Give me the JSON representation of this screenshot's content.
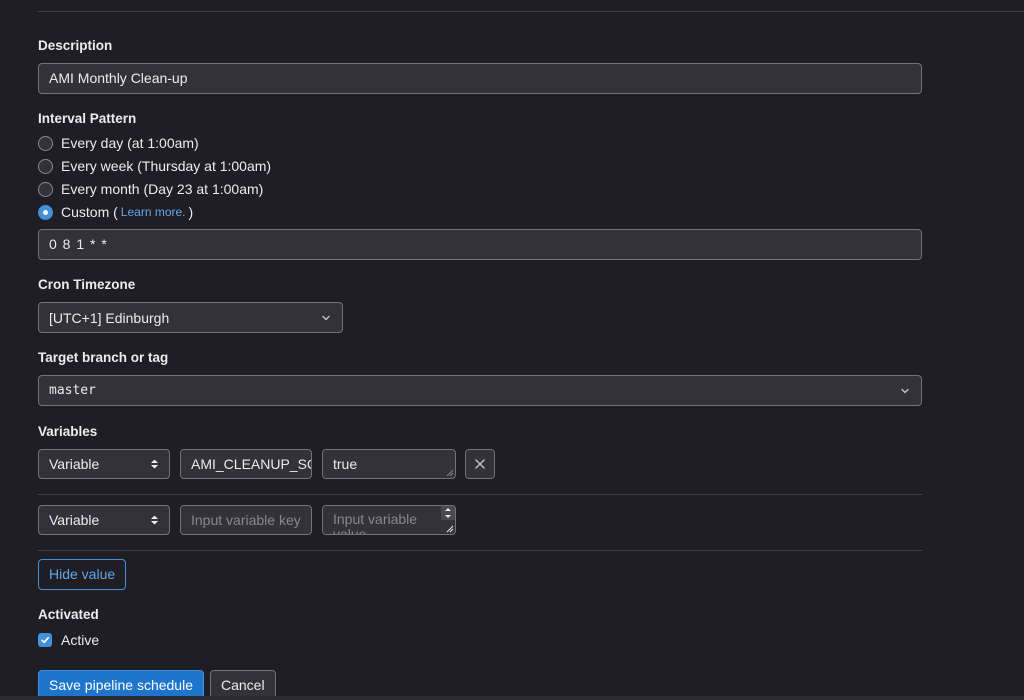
{
  "description": {
    "label": "Description",
    "value": "AMI Monthly Clean-up"
  },
  "interval_pattern": {
    "label": "Interval Pattern",
    "options": [
      {
        "label": "Every day (at 1:00am)",
        "checked": false
      },
      {
        "label": "Every week (Thursday at 1:00am)",
        "checked": false
      },
      {
        "label": "Every month (Day 23 at 1:00am)",
        "checked": false
      },
      {
        "label": "Custom (",
        "checked": true
      }
    ],
    "learn_more": "Learn more.",
    "custom_close": ")",
    "cron_value": "0 8 1 * *"
  },
  "cron_timezone": {
    "label": "Cron Timezone",
    "selected": "[UTC+1] Edinburgh"
  },
  "target_branch": {
    "label": "Target branch or tag",
    "selected": "master"
  },
  "variables": {
    "label": "Variables",
    "rows": [
      {
        "type": "Variable",
        "key": "AMI_CLEANUP_SC",
        "value": "true"
      },
      {
        "type": "Variable",
        "key_placeholder": "Input variable key",
        "value_placeholder": "Input variable value"
      }
    ],
    "hide_value_label": "Hide value"
  },
  "activated": {
    "label": "Activated",
    "checkbox_label": "Active",
    "checked": true
  },
  "actions": {
    "save_label": "Save pipeline schedule",
    "cancel_label": "Cancel"
  },
  "colors": {
    "background": "#1f1e24",
    "accent": "#428fdc",
    "input_background": "#333238",
    "border": "#737278"
  }
}
